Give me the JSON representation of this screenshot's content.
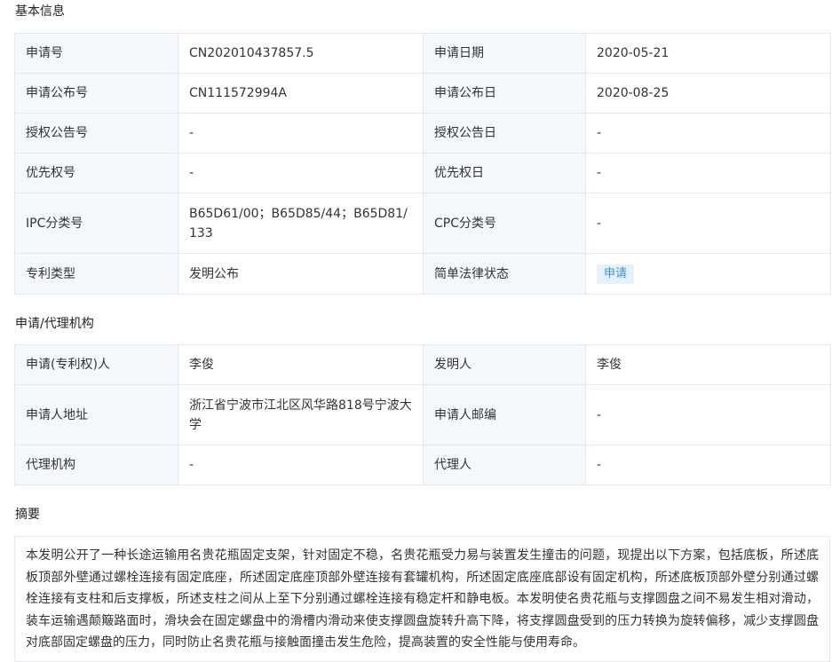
{
  "basic": {
    "title": "基本信息",
    "rows": [
      [
        {
          "label": "申请号",
          "value": "CN202010437857.5"
        },
        {
          "label": "申请日期",
          "value": "2020-05-21"
        }
      ],
      [
        {
          "label": "申请公布号",
          "value": "CN111572994A"
        },
        {
          "label": "申请公布日",
          "value": "2020-08-25"
        }
      ],
      [
        {
          "label": "授权公告号",
          "value": "-"
        },
        {
          "label": "授权公告日",
          "value": "-"
        }
      ],
      [
        {
          "label": "优先权号",
          "value": "-"
        },
        {
          "label": "优先权日",
          "value": "-"
        }
      ],
      [
        {
          "label": "IPC分类号",
          "value": "B65D61/00；B65D85/44；B65D81/133"
        },
        {
          "label": "CPC分类号",
          "value": "-"
        }
      ],
      [
        {
          "label": "专利类型",
          "value": "发明公布"
        },
        {
          "label": "简单法律状态",
          "value": "申请"
        }
      ]
    ]
  },
  "agency": {
    "title": "申请/代理机构",
    "rows": [
      [
        {
          "label": "申请(专利权)人",
          "value": "李俊"
        },
        {
          "label": "发明人",
          "value": "李俊"
        }
      ],
      [
        {
          "label": "申请人地址",
          "value": "浙江省宁波市江北区风华路818号宁波大学"
        },
        {
          "label": "申请人邮编",
          "value": "-"
        }
      ],
      [
        {
          "label": "代理机构",
          "value": "-"
        },
        {
          "label": "代理人",
          "value": "-"
        }
      ]
    ]
  },
  "abstract": {
    "title": "摘要",
    "text": "本发明公开了一种长途运输用名贵花瓶固定支架，针对固定不稳，名贵花瓶受力易与装置发生撞击的问题，现提出以下方案，包括底板，所述底板顶部外壁通过螺栓连接有固定底座，所述固定底座顶部外壁连接有套罐机构，所述固定底座底部设有固定机构，所述底板顶部外壁分别通过螺栓连接有支柱和后支撑板，所述支柱之间从上至下分别通过螺栓连接有稳定杆和静电板。本发明使名贵花瓶与支撑圆盘之间不易发生相对滑动，装车运输遇颠簸路面时，滑块会在固定螺盘中的滑槽内滑动来使支撑圆盘旋转升高下降，将支撑圆盘受到的压力转换为旋转偏移，减少支撑圆盘对底部固定螺盘的压力，同时防止名贵花瓶与接触面撞击发生危险，提高装置的安全性能与使用寿命。"
  },
  "colors": {
    "label_bg": "#f4f7fb",
    "border": "#e4e8ee",
    "badge_bg": "#e6f2fb",
    "badge_text": "#3b8fd6"
  }
}
